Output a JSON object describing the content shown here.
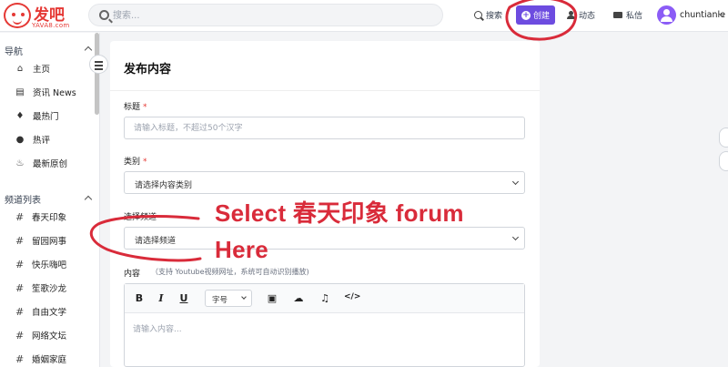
{
  "app": {
    "logo_text": "发吧",
    "logo_sub": "YAVA8.com"
  },
  "header": {
    "search_placeholder": "搜索...",
    "search_label": "搜索",
    "create_label": "创建",
    "activity_label": "动态",
    "messages_label": "私信",
    "username": "chuntianle"
  },
  "sidebar": {
    "nav_title": "导航",
    "nav_items": [
      {
        "label": "主页",
        "icon": "home-icon"
      },
      {
        "label": "资讯 News",
        "icon": "news-icon"
      },
      {
        "label": "最热门",
        "icon": "fire-icon"
      },
      {
        "label": "热评",
        "icon": "comment-icon"
      },
      {
        "label": "最新原创",
        "icon": "flame-icon"
      }
    ],
    "channels_title": "频道列表",
    "channels": [
      "春天印象",
      "留园网事",
      "快乐嗨吧",
      "笙歌沙龙",
      "自由文学",
      "网络文坛",
      "婚姻家庭"
    ]
  },
  "form": {
    "title": "发布内容",
    "title_label": "标题",
    "title_placeholder": "请输入标题，不超过50个汉字",
    "category_label": "类别",
    "category_value": "请选择内容类别",
    "channel_label": "选择频道",
    "channel_value": "请选择频道",
    "content_label": "内容",
    "content_hint": "（支持 Youtube视频网址，系统可自动识别播放)",
    "font_size_label": "字号",
    "editor_placeholder": "请输入内容..."
  },
  "annotation": {
    "line1": "Select 春天印象 forum",
    "line2": "Here",
    "color": "#d92b3a"
  },
  "colors": {
    "accent": "#6d4ce0",
    "brand": "#e53935"
  }
}
